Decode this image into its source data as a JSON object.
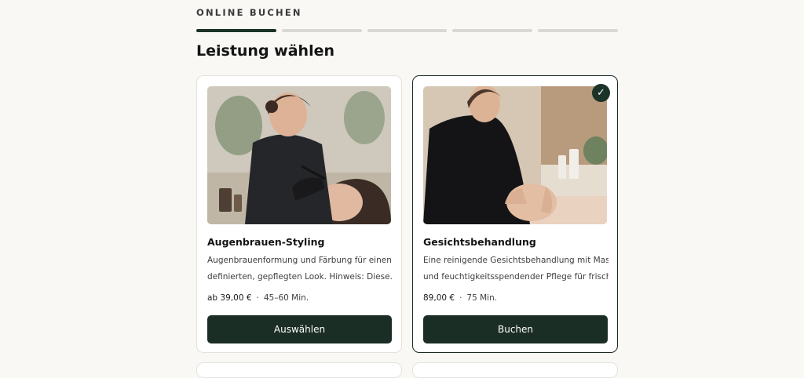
{
  "header": {
    "kicker": "ONLINE BUCHEN",
    "steps_total": 5,
    "steps_active": 1,
    "heading": "Leistung wählen"
  },
  "services": [
    {
      "title": "Augenbrauen-Styling",
      "desc_line1": "Augenbrauenformung und Färbung für einen",
      "desc_line2": "definierten, gepflegten Look. Hinweis: Diese…",
      "price": "ab 39,00 €",
      "sep": "·",
      "duration": "45–60 Min.",
      "button": "Auswählen",
      "selected": false,
      "image_icon": "eyebrow-styling-photo"
    },
    {
      "title": "Gesichtsbehandlung",
      "desc_line1": "Eine reinigende Gesichtsbehandlung mit Maske",
      "desc_line2": "und feuchtigkeitsspendender Pflege für frisch…",
      "price": "89,00 €",
      "sep": "·",
      "duration": "75 Min.",
      "button": "Buchen",
      "selected": true,
      "check": "✓",
      "image_icon": "facial-treatment-photo"
    }
  ],
  "colors": {
    "accent": "#1c3327",
    "button_bg": "#1b2e25",
    "step_inactive": "#d9d8d4",
    "page_bg": "#f9f8f5"
  }
}
